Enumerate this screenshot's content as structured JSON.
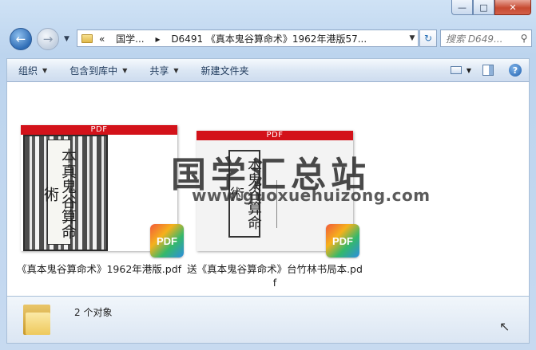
{
  "window": {
    "caption_buttons": [
      "—",
      "□",
      "✕"
    ]
  },
  "nav": {
    "back_icon": "back-arrow-icon",
    "forward_icon": "forward-arrow-icon",
    "address_segments": [
      "«",
      "国学...",
      "▸",
      "D6491 《真本鬼谷算命术》1962年港版57..."
    ],
    "search_placeholder": "搜索 D649..."
  },
  "cmdbar": {
    "organize": "组织",
    "include_library": "包含到库中",
    "share": "共享",
    "new_folder": "新建文件夹"
  },
  "files": [
    {
      "thumb_label": "PDF",
      "badge": "PDF",
      "name": "《真本鬼谷算命术》1962年港版.pdf",
      "cover_text": "本真鬼谷算命術"
    },
    {
      "thumb_label": "PDF",
      "badge": "PDF",
      "name": "送《真本鬼谷算命术》台竹林书局本.pdf",
      "cover_text": "本鬼谷算命術"
    }
  ],
  "watermark": {
    "logo": "国学汇总站",
    "url": "www.guoxuehuizong.com"
  },
  "details": {
    "count": "2 个对象"
  }
}
